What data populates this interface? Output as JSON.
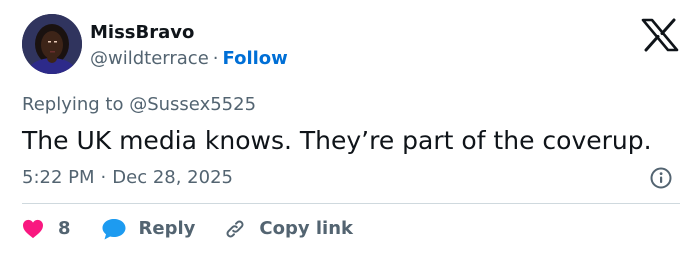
{
  "author": {
    "name": "MissBravo",
    "handle": "@wildterrace",
    "separator": "·",
    "follow_label": "Follow"
  },
  "reply_context": {
    "prefix": "Replying to",
    "mention": "@Sussex5525"
  },
  "tweet": {
    "text": "The UK media knows. They’re part of the coverup."
  },
  "meta": {
    "time": "5:22 PM",
    "separator": "·",
    "date": "Dec 28, 2025"
  },
  "actions": {
    "like_count": "8",
    "reply_label": "Reply",
    "copy_label": "Copy link"
  },
  "icons": {
    "logo": "x-logo-icon",
    "info": "info-icon",
    "like": "heart-icon",
    "reply": "speech-bubble-icon",
    "copy": "link-icon"
  },
  "colors": {
    "text": "#0f1419",
    "secondary": "#536471",
    "link": "#006fd6",
    "heart": "#f91880",
    "reply_bubble": "#1d9bf0",
    "divider": "#cfd9de"
  }
}
